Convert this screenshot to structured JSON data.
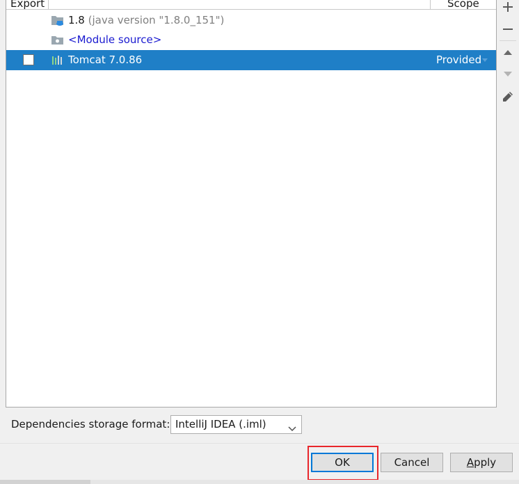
{
  "table": {
    "headers": {
      "export": "Export",
      "scope": "Scope"
    },
    "rows": [
      {
        "name": "1.8",
        "detail": "(java version \"1.8.0_151\")",
        "icon": "jdk-folder-icon",
        "has_checkbox": false
      },
      {
        "name": "<Module source>",
        "icon": "module-folder-icon",
        "has_checkbox": false
      },
      {
        "name": "Tomcat 7.0.86",
        "icon": "library-icon",
        "has_checkbox": true,
        "checked": false,
        "scope": "Provided",
        "selected": true
      }
    ]
  },
  "toolbar": {
    "add": "add-icon",
    "remove": "remove-icon",
    "move_up": "arrow-up-icon",
    "move_down": "arrow-down-icon",
    "edit": "pencil-icon"
  },
  "storage": {
    "label": "Dependencies storage format:",
    "selected": "IntelliJ IDEA (.iml)"
  },
  "buttons": {
    "ok": "OK",
    "cancel": "Cancel",
    "apply_mnemonic": "A",
    "apply_rest": "pply"
  },
  "colors": {
    "selection": "#1f7fc7",
    "highlight_border": "#e8262b",
    "default_button_border": "#0078d7",
    "module_source_text": "#1a1ad0"
  }
}
